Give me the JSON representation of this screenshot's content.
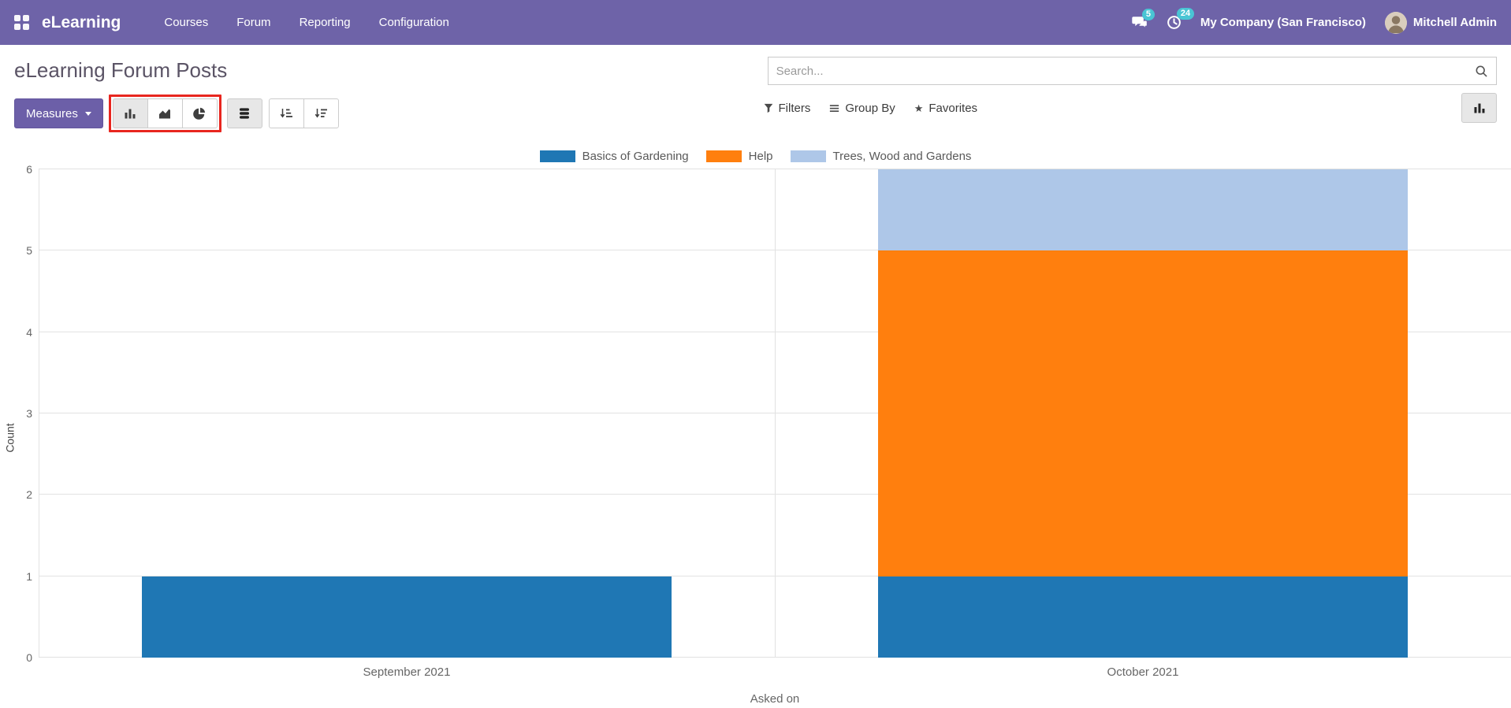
{
  "navbar": {
    "brand": "eLearning",
    "menu": [
      "Courses",
      "Forum",
      "Reporting",
      "Configuration"
    ],
    "messages_badge": "5",
    "activities_badge": "24",
    "company": "My Company (San Francisco)",
    "user": "Mitchell Admin"
  },
  "header": {
    "title": "eLearning Forum Posts",
    "search_placeholder": "Search..."
  },
  "toolbar": {
    "measures_label": "Measures",
    "filters_label": "Filters",
    "group_by_label": "Group By",
    "favorites_label": "Favorites"
  },
  "icons": {
    "apps": "grid-squares",
    "messages": "chat-bubbles",
    "activities": "clock",
    "search": "magnifier",
    "bar_chart": "bar-chart",
    "line_chart": "area-chart",
    "pie_chart": "pie-chart",
    "stacked": "stack-layers",
    "sort_asc": "bars-arrow-down-asc",
    "sort_desc": "bars-arrow-down-desc",
    "filters": "funnel",
    "group_by": "horizontal-bars",
    "favorites": "star",
    "view_switcher_graph": "bar-chart"
  },
  "colors": {
    "navbar_bg": "#6e63a8",
    "primary_button": "#6c5fa8",
    "annotation_highlight": "#e8261f",
    "badge_bg": "#49c5d4"
  },
  "chart_data": {
    "type": "bar",
    "stacked": true,
    "title": "",
    "xlabel": "Asked on",
    "ylabel": "Count",
    "categories": [
      "September 2021",
      "October 2021"
    ],
    "series": [
      {
        "name": "Basics of Gardening",
        "color": "#1f77b4",
        "values": [
          1,
          1
        ]
      },
      {
        "name": "Help",
        "color": "#ff7f0e",
        "values": [
          0,
          4
        ]
      },
      {
        "name": "Trees, Wood and Gardens",
        "color": "#aec7e8",
        "values": [
          0,
          1
        ]
      }
    ],
    "ylim": [
      0,
      6
    ],
    "yticks": [
      0,
      1,
      2,
      3,
      4,
      5,
      6
    ],
    "legend_position": "top",
    "grid": true
  }
}
